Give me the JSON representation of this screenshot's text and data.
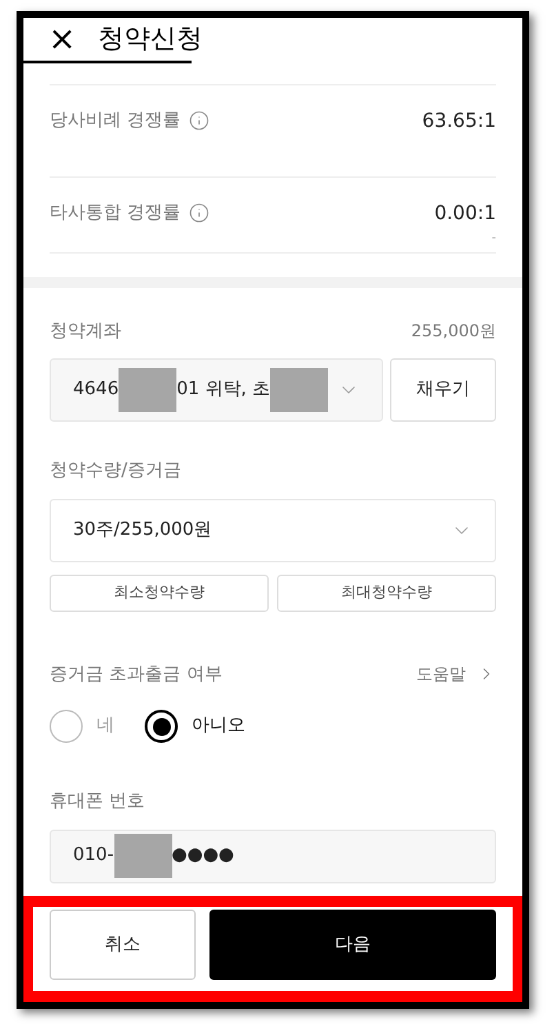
{
  "header": {
    "close": "×",
    "title": "청약신청"
  },
  "rates": [
    {
      "label": "당사비례 경쟁률",
      "value": "63.65:1"
    },
    {
      "label": "타사통합 경쟁률",
      "value": "0.00:1",
      "note": "-"
    }
  ],
  "account": {
    "label": "청약계좌",
    "amount": "255,000원",
    "value_parts": [
      {
        "kind": "text",
        "text": "4646"
      },
      {
        "kind": "mask"
      },
      {
        "kind": "text",
        "text": "01 위탁, 초"
      },
      {
        "kind": "mask"
      }
    ],
    "fill_button": "채우기"
  },
  "quantity": {
    "label": "청약수량/증거금",
    "value": "30주/255,000원",
    "buttons": [
      "최소청약수량",
      "최대청약수량"
    ]
  },
  "excess_withdrawal": {
    "label": "증거금 초과출금 여부",
    "help": "도움말",
    "options": [
      {
        "label": "네",
        "selected": false
      },
      {
        "label": "아니오",
        "selected": true
      }
    ]
  },
  "phone": {
    "label": "휴대폰 번호",
    "value_parts": [
      {
        "kind": "text",
        "text": "010-"
      },
      {
        "kind": "mask"
      },
      {
        "kind": "text",
        "text": "●●●●"
      }
    ]
  },
  "footer": {
    "highlighted": true,
    "cancel": "취소",
    "next": "다음"
  }
}
